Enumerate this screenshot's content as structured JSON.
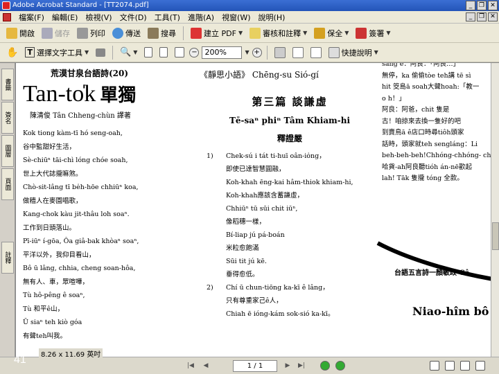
{
  "app": {
    "title": "Adobe Acrobat Standard - [TT2074.pdf]"
  },
  "menu": [
    "檔案(F)",
    "編輯(E)",
    "檢視(V)",
    "文件(D)",
    "工具(T)",
    "進階(A)",
    "視窗(W)",
    "說明(H)"
  ],
  "toolbar1": {
    "open": "開啟",
    "save": "儲存",
    "print": "列印",
    "email": "傳送",
    "search": "搜尋",
    "create_pdf": "建立 PDF",
    "review": "審核和註釋",
    "secure": "保全",
    "sign": "簽署"
  },
  "toolbar2": {
    "select_text": "選擇文字工具",
    "zoom": "200%",
    "quick_help": "快捷說明"
  },
  "sidetabs": [
    "書籤",
    "簽名",
    "圖層",
    "頁面",
    "註釋"
  ],
  "colA": {
    "header": "荒漠甘泉台語詩(20)",
    "title_roman": "Tan-to̍k",
    "title_han": "單獨",
    "author": "陳清俊  Tân Chheng-chùn 譯著",
    "lines": [
      "Kok tiong kàm-tī  hó seng-oah,",
      "谷中監甜好生活，",
      "Sè-chiūⁿ tāi-chì lóng chóe soah,",
      "世上大代誌攏嘛煞。",
      "Chò-sit-lâng tī be̍h-hōe chhiūⁿ koa,",
      "做穡人在麥園唱歌，",
      "Kang-chok kàu jit-thâu loh soaⁿ.",
      "工作到日頭落山。",
      "Pī-iūⁿ í-gōa, Ôa giâ-bak khòaⁿ soaⁿ,",
      "平洋以外，我仰目看山，",
      "Bô ū lâng, chhia, cheng soan-hôa,",
      "無有人、車，眾喧嘩，",
      "Tù hô-pêng ê soaⁿ,",
      "Tù 和平ê山，",
      "Ū siaⁿ teh kiò góa",
      "有聲teh叫我。"
    ]
  },
  "colB": {
    "series": "《靜思小語》  Chēng-su  Sió-gí",
    "chapter": "第三篇    談謙虛",
    "chapter_rom": "Tē-saⁿ phiⁿ   Tâm Khiam-hi",
    "subtitle": "釋證嚴",
    "items": [
      {
        "num": "1)",
        "lines": [
          "Chek-sú i tát ti-huī oân-io̍ng，",
          "即使已達智慧圓融，",
          "Koh-khah ēng-kai hâm-thiok khiam-hi,",
          "Koh-khah應該含蓄謙虛，",
          "Chhiūⁿ tū sūi chit iūⁿ,",
          "像稻穗一樣，",
          "Bí-liap jú pá-boán",
          "米粒愈飽滿",
          "Sūi tit jú kē.",
          "垂得愈低。"
        ]
      },
      {
        "num": "2)",
        "lines": [
          "Chí ū chun-tiōng ka-kī ê lâng，",
          "只有尊重家己ê人，",
          "Chiah ē ióng-kám sok-sió ka-kī。"
        ]
      }
    ]
  },
  "colC": {
    "lines": [
      "sàng è：阿良：「阿良…」",
      "無停，ka 偷偷tòe teh講 tē sì",
      "hit 筊島ā soah大聲hoah:「教一",
      "o h！」",
      "  阿良：阿爸，chit 隻是",
      "古！咱掠來去換一隻好的吧",
      "到賣鳥ā ê店口時尋tiôh頭家",
      "話時，頭家就teh sengláng：Li",
      "beh-beh-beh!Chhóng-chhóng- chi",
      "哈貨-ah阿良聽tióh án-nē歡起",
      "lah! Tāk 隻攏 tóng 全款。"
    ],
    "poem": "台語五言詩一顏敏政  Gâ",
    "heading": "Niao-hîm bô oa"
  },
  "status": {
    "page_size": "8.26 x 11.69 英吋",
    "page_field": "1 / 1",
    "slide_number": "41"
  }
}
